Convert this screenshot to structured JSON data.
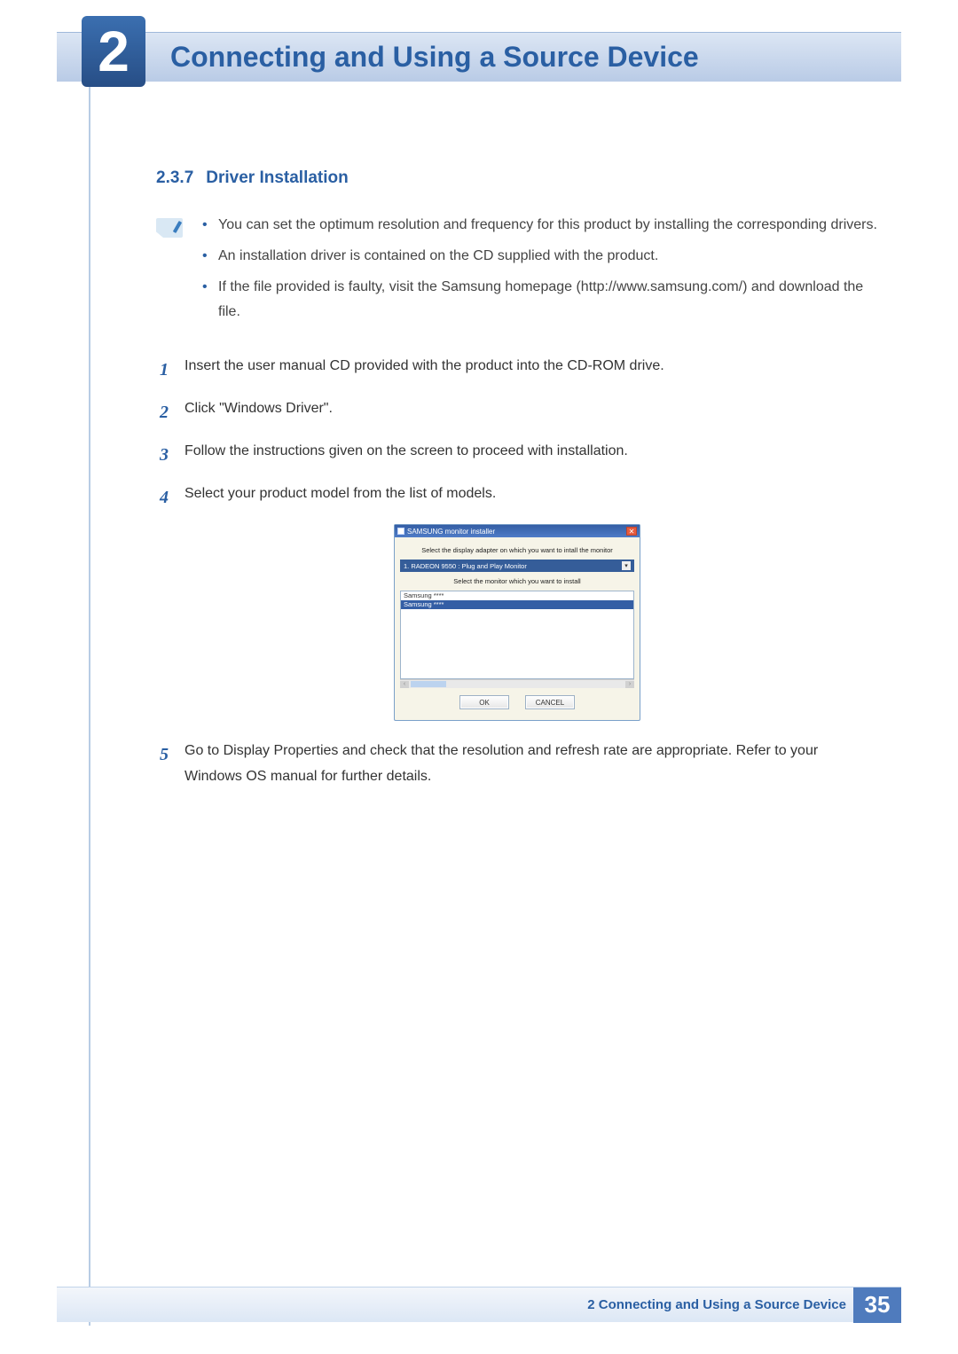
{
  "header": {
    "chapter_number": "2",
    "chapter_title": "Connecting and Using a Source Device"
  },
  "section": {
    "number": "2.3.7",
    "title": "Driver Installation"
  },
  "info_bullets": [
    "You can set the optimum resolution and frequency for this product by installing the corresponding drivers.",
    "An installation driver is contained on the CD supplied with the product.",
    "If the file provided is faulty, visit the Samsung homepage (http://www.samsung.com/) and download the file."
  ],
  "steps": [
    {
      "num": "1",
      "text": "Insert the user manual CD provided with the product into the CD-ROM drive."
    },
    {
      "num": "2",
      "text": "Click \"Windows Driver\"."
    },
    {
      "num": "3",
      "text": "Follow the instructions given on the screen to proceed with installation."
    },
    {
      "num": "4",
      "text": "Select your product model from the list of models."
    },
    {
      "num": "5",
      "text": "Go to Display Properties and check that the resolution and refresh rate are appropriate. Refer to your Windows OS manual for further details."
    }
  ],
  "installer": {
    "title": "SAMSUNG monitor installer",
    "prompt1": "Select the display adapter on which you want to intall the monitor",
    "adapter": "1. RADEON 9550 : Plug and Play Monitor",
    "prompt2": "Select the monitor which you want to install",
    "list_item1": "Samsung ****",
    "list_item2": "Samsung ****",
    "ok": "OK",
    "cancel": "CANCEL"
  },
  "footer": {
    "text": "2 Connecting and Using a Source Device",
    "page": "35"
  }
}
